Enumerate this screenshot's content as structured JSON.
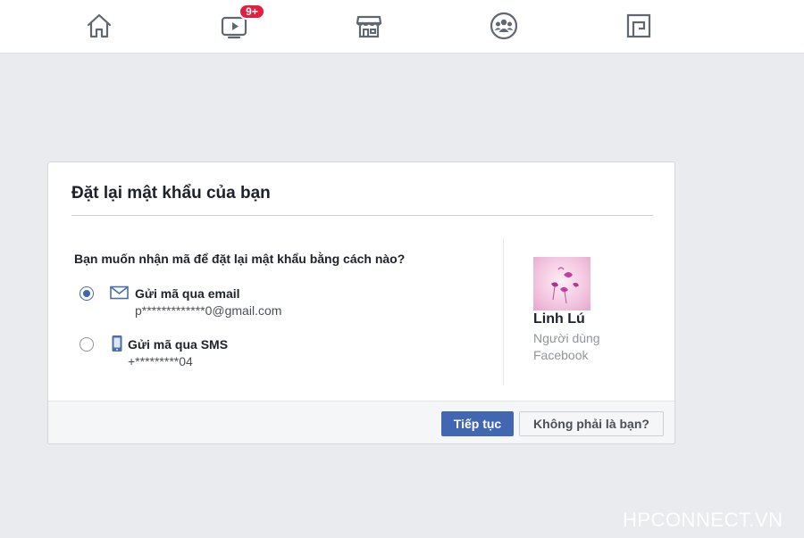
{
  "nav": {
    "watch_badge": "9+"
  },
  "dialog": {
    "title": "Đặt lại mật khẩu của bạn",
    "question": "Bạn muốn nhận mã để đặt lại mật khẩu bằng cách nào?",
    "options": [
      {
        "label": "Gửi mã qua email",
        "detail": "p*************0@gmail.com",
        "selected": true,
        "icon": "envelope-icon"
      },
      {
        "label": "Gửi mã qua SMS",
        "detail": "+*********04",
        "selected": false,
        "icon": "phone-icon"
      }
    ],
    "profile": {
      "name": "Linh Lú",
      "sub_line1": "Người dùng",
      "sub_line2": "Facebook"
    },
    "continue_label": "Tiếp tục",
    "not_you_label": "Không phải là bạn?"
  },
  "watermark": "HPCONNECT.VN",
  "colors": {
    "accent": "#4267b2",
    "badge": "#e41e3f",
    "background": "#e9ebee"
  }
}
